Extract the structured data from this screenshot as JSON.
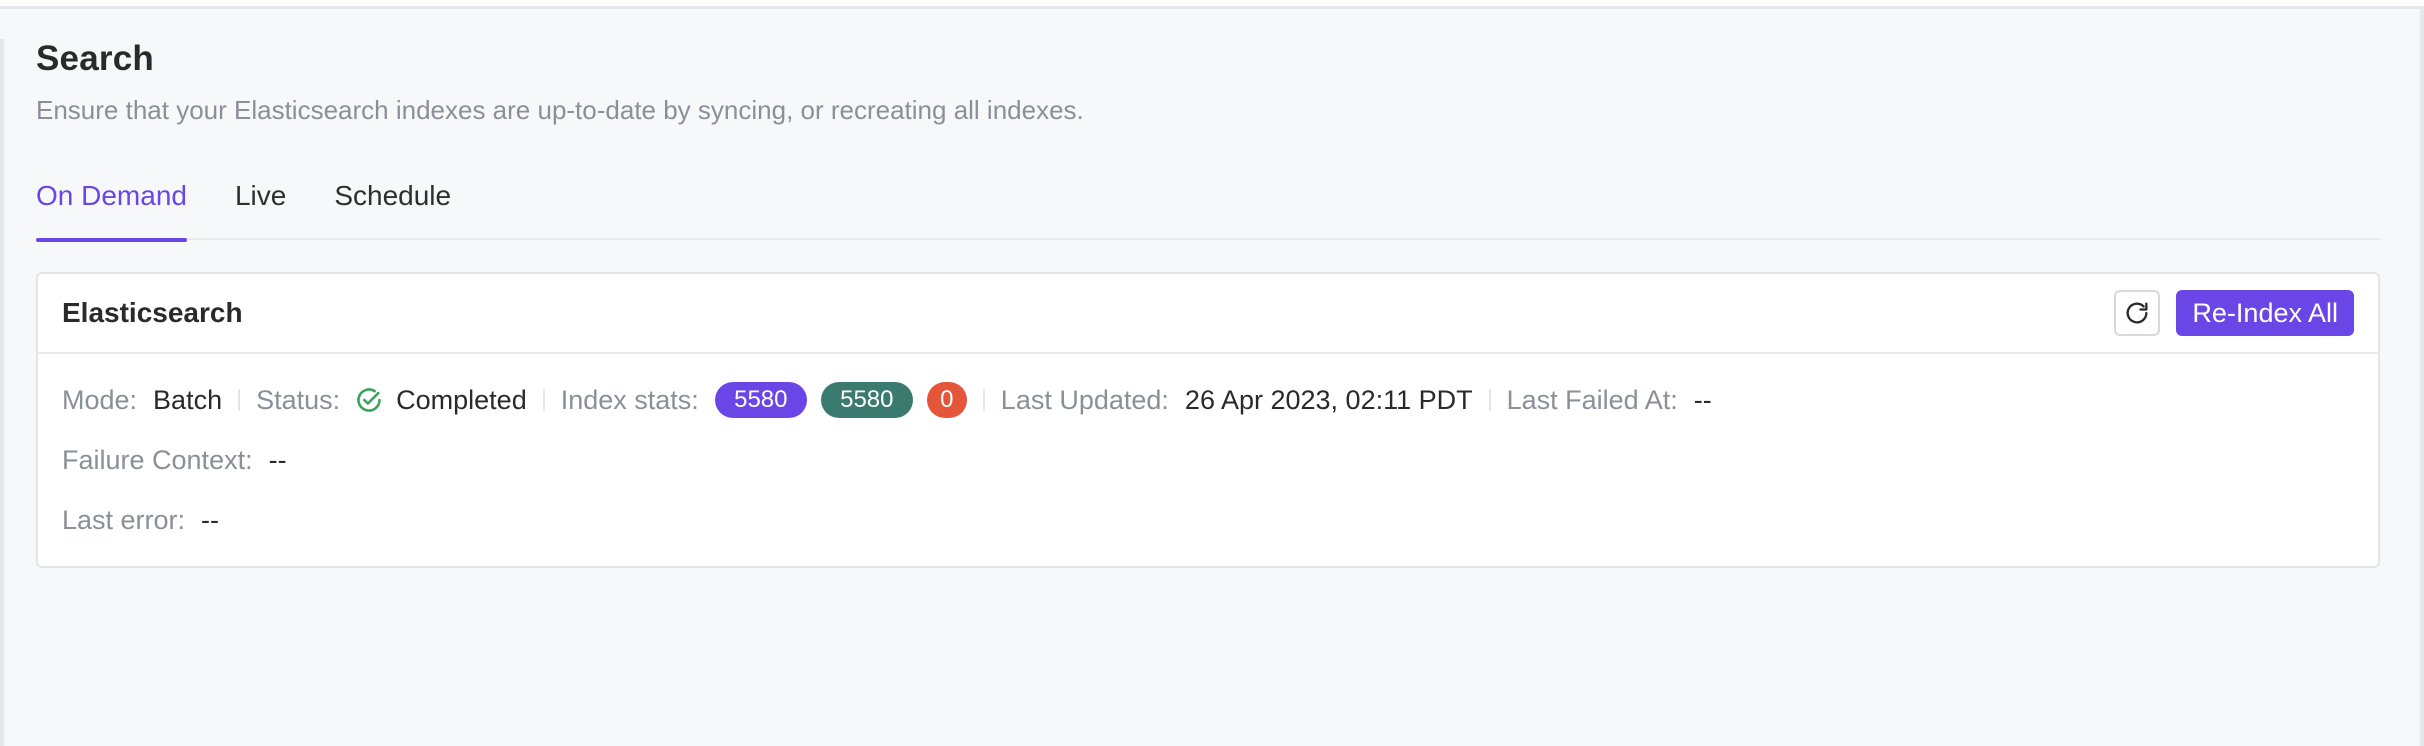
{
  "header": {
    "title": "Search",
    "subtitle": "Ensure that your Elasticsearch indexes are up-to-date by syncing, or recreating all indexes."
  },
  "tabs": [
    {
      "label": "On Demand",
      "active": true
    },
    {
      "label": "Live",
      "active": false
    },
    {
      "label": "Schedule",
      "active": false
    }
  ],
  "card": {
    "title": "Elasticsearch",
    "refresh_icon": "refresh-icon",
    "reindex_label": "Re-Index All",
    "mode_label": "Mode:",
    "mode_value": "Batch",
    "status_label": "Status:",
    "status_icon": "check-circle-icon",
    "status_value": "Completed",
    "index_stats_label": "Index stats:",
    "index_stats": {
      "total": "5580",
      "success": "5580",
      "failed": "0"
    },
    "last_updated_label": "Last Updated:",
    "last_updated_value": "26 Apr 2023, 02:11 PDT",
    "last_failed_label": "Last Failed At:",
    "last_failed_value": "--",
    "failure_context_label": "Failure Context:",
    "failure_context_value": "--",
    "last_error_label": "Last error:",
    "last_error_value": "--"
  },
  "colors": {
    "accent": "#6b46e6",
    "success_badge": "#3b7a6e",
    "danger_badge": "#e5553a",
    "status_check": "#3aa35a"
  }
}
